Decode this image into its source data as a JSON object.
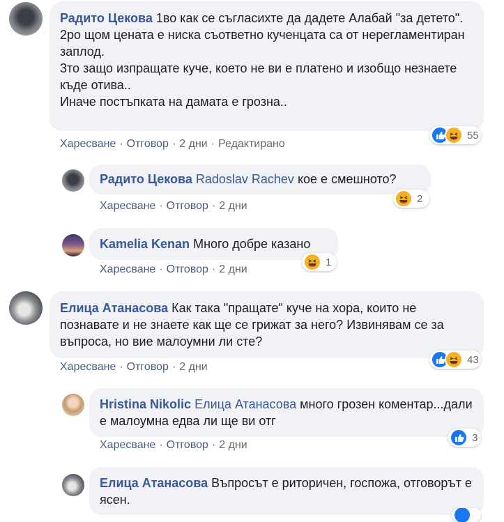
{
  "colors": {
    "bubble": "#f0f2f5",
    "author": "#385898",
    "meta": "#65676b",
    "like": "#1877f2",
    "haha": "#f7b125"
  },
  "comments": [
    {
      "author": "Радито Цекова",
      "text": "1во как се съгласихте да дадете Алабай \"за детето\".\n2ро щом цената е ниска съответно кученцата са от нерегламентиран заплод.\n3то защо изпращате куче, което не ви е платено и изобщо незнаете къде отива..\nИначе постъпката на дамата е грозна..",
      "like": "Харесване",
      "reply": "Отговор",
      "time": "2 дни",
      "edited": "Редактирано",
      "reactions": {
        "icons": [
          "like-icon",
          "haha-icon"
        ],
        "count": "55"
      }
    },
    {
      "author": "Радито Цекова",
      "mention": "Radoslav Rachev",
      "text": "кое е смешното?",
      "like": "Харесване",
      "reply": "Отговор",
      "time": "2 дни",
      "reactions": {
        "icons": [
          "haha-icon"
        ],
        "count": "2"
      }
    },
    {
      "author": "Kamelia Kenan",
      "text": "Много добре казано",
      "like": "Харесване",
      "reply": "Отговор",
      "time": "2 дни",
      "reactions": {
        "icons": [
          "haha-icon"
        ],
        "count": "1"
      }
    },
    {
      "author": "Елица Атанасова",
      "text": "Как така \"пращате\" куче на хора, които не познавате и не знаете как ще се грижат за него? Извинявам се за въпроса, но вие малоумни ли сте?",
      "like": "Харесване",
      "reply": "Отговор",
      "time": "2 дни",
      "reactions": {
        "icons": [
          "like-icon",
          "haha-icon"
        ],
        "count": "43"
      }
    },
    {
      "author": "Hristina Nikolic",
      "mention": "Елица Атанасова",
      "text": "много грозен коментар...дали е малоумна едва ли ще ви отг",
      "like": "Харесване",
      "reply": "Отговор",
      "time": "2 дни",
      "reactions": {
        "icons": [
          "like-icon"
        ],
        "count": "3"
      }
    },
    {
      "author": "Елица Атанасова",
      "text": "Въпросът е риторичен, госпожа, отговорът е ясен.",
      "reactions": {
        "icons": [
          "like-icon"
        ]
      }
    }
  ]
}
